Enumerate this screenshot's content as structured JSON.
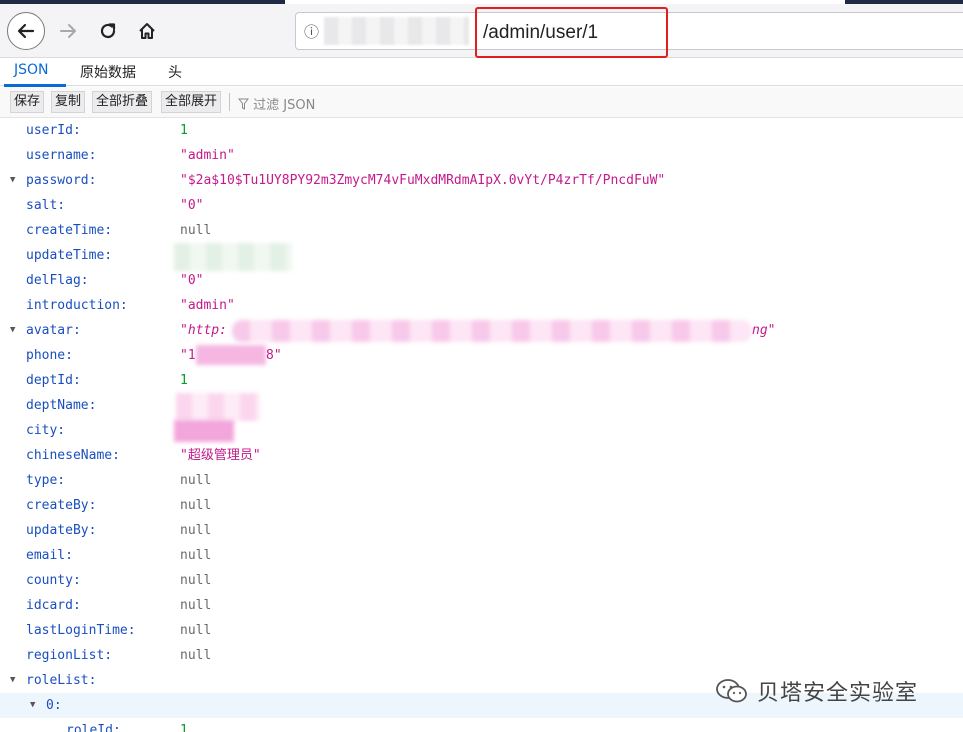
{
  "browser": {
    "url_path": "/admin/user/1"
  },
  "tabs": [
    {
      "label": "JSON"
    },
    {
      "label": "原始数据"
    },
    {
      "label": "头"
    }
  ],
  "toolbar": {
    "save_label": "保存",
    "copy_label": "复制",
    "collapse_all_label": "全部折叠",
    "expand_all_label": "全部展开",
    "filter_placeholder": "过滤 JSON"
  },
  "json_tree": [
    {
      "key": "userId:",
      "value": "1",
      "type": "number"
    },
    {
      "key": "username:",
      "value": "\"admin\"",
      "type": "string"
    },
    {
      "key": "password:",
      "value": "\"$2a$10$Tu1UY8PY92m3ZmycM74vFuMxdMRdmAIpX.0vYt/P4zrTf/PncdFuW\"",
      "type": "string"
    },
    {
      "key": "salt:",
      "value": "\"0\"",
      "type": "string"
    },
    {
      "key": "createTime:",
      "value": "null",
      "type": "null"
    },
    {
      "key": "updateTime:",
      "value": "",
      "type": "redacted"
    },
    {
      "key": "delFlag:",
      "value": "\"0\"",
      "type": "string"
    },
    {
      "key": "introduction:",
      "value": "\"admin\"",
      "type": "string"
    },
    {
      "key": "avatar:",
      "value_start": "\"http:",
      "value_end": "ng\"",
      "type": "redacted-string"
    },
    {
      "key": "phone:",
      "value_start": "\"1",
      "value_end": "8\"",
      "type": "redacted-string"
    },
    {
      "key": "deptId:",
      "value": "1",
      "type": "number"
    },
    {
      "key": "deptName:",
      "value": "",
      "type": "redacted"
    },
    {
      "key": "city:",
      "value": "",
      "type": "redacted"
    },
    {
      "key": "chineseName:",
      "value": "\"超级管理员\"",
      "type": "string"
    },
    {
      "key": "type:",
      "value": "null",
      "type": "null"
    },
    {
      "key": "createBy:",
      "value": "null",
      "type": "null"
    },
    {
      "key": "updateBy:",
      "value": "null",
      "type": "null"
    },
    {
      "key": "email:",
      "value": "null",
      "type": "null"
    },
    {
      "key": "county:",
      "value": "null",
      "type": "null"
    },
    {
      "key": "idcard:",
      "value": "null",
      "type": "null"
    },
    {
      "key": "lastLoginTime:",
      "value": "null",
      "type": "null"
    },
    {
      "key": "regionList:",
      "value": "null",
      "type": "null"
    },
    {
      "key": "roleList:",
      "value": "",
      "type": "array"
    },
    {
      "key": "0:",
      "value": "",
      "type": "object"
    },
    {
      "key": "roleId:",
      "value": "1",
      "type": "number"
    }
  ],
  "watermark": {
    "text": "贝塔安全实验室"
  },
  "colors": {
    "key": "#1a4fbf",
    "string": "#c41a8b",
    "number": "#059c27",
    "null": "#6a6a6a",
    "accent": "#0a6bd6",
    "highlight_box": "#e01e1e"
  }
}
